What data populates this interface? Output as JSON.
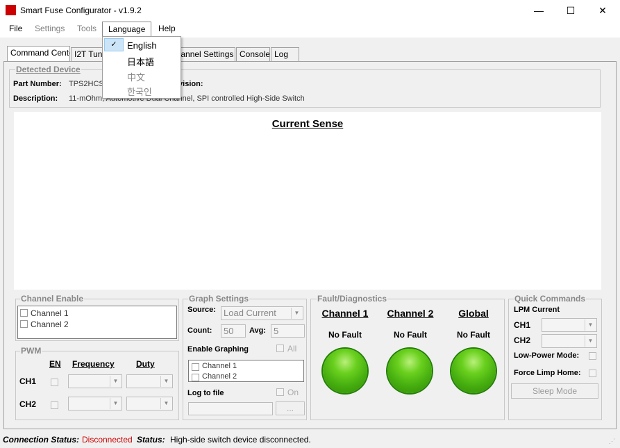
{
  "window": {
    "title": "Smart Fuse Configurator - v1.9.2",
    "minimize_glyph": "—",
    "maximize_glyph": "☐",
    "close_glyph": "✕"
  },
  "menu": {
    "file": "File",
    "settings": "Settings",
    "tools": "Tools",
    "language": "Language",
    "help": "Help"
  },
  "language_menu": {
    "items": [
      "English",
      "日本語",
      "中文",
      "한국인"
    ],
    "checked": "English"
  },
  "tabs": [
    "Command Center",
    "I2T Tuner",
    "Channel Settings",
    "Console",
    "Log"
  ],
  "detected_device": {
    "title": "Detected Device",
    "part_number_label": "Part Number:",
    "part_number_value": "TPS2HCS",
    "revision_label": "Revision:",
    "description_label": "Description:",
    "description_value": "11-mOhm, Automotive Dual Channel, SPI controlled High-Side Switch"
  },
  "plot": {
    "title": "Current Sense"
  },
  "channel_enable": {
    "title": "Channel Enable",
    "items": [
      "Channel 1",
      "Channel 2"
    ]
  },
  "pwm": {
    "title": "PWM",
    "col_en": "EN",
    "col_frequency": "Frequency",
    "col_duty": "Duty",
    "rows": [
      "CH1",
      "CH2"
    ]
  },
  "graph_settings": {
    "title": "Graph Settings",
    "source_label": "Source:",
    "source_value": "Load Current",
    "count_label": "Count:",
    "count_value": "50",
    "avg_label": "Avg:",
    "avg_value": "5",
    "enable_graphing_label": "Enable Graphing",
    "all_label": "All",
    "channels": [
      "Channel 1",
      "Channel 2"
    ],
    "log_label": "Log to file",
    "on_label": "On",
    "browse_label": "..."
  },
  "fault": {
    "title": "Fault/Diagnostics",
    "columns": [
      {
        "header": "Channel 1",
        "status": "No Fault"
      },
      {
        "header": "Channel 2",
        "status": "No Fault"
      },
      {
        "header": "Global",
        "status": "No Fault"
      }
    ],
    "led_color": "#5cc416"
  },
  "quick_commands": {
    "title": "Quick Commands",
    "lpm_current_label": "LPM Current",
    "ch1_label": "CH1",
    "ch2_label": "CH2",
    "low_power_label": "Low-Power Mode:",
    "force_limp_label": "Force Limp Home:",
    "sleep_button": "Sleep Mode"
  },
  "status_bar": {
    "connection_label": "Connection Status:",
    "connection_value": "Disconnected",
    "connection_color": "#cc0000",
    "status_label": "Status:",
    "status_value": "High-side switch device disconnected."
  }
}
